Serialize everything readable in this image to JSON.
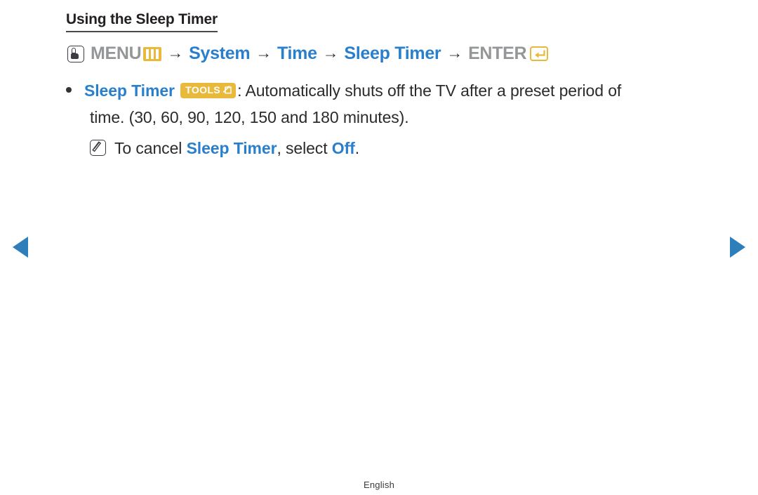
{
  "page": {
    "title": "Using the Sleep Timer",
    "language_footer": "English"
  },
  "menu_path": {
    "press_icon": "menu-press-icon",
    "menu_label": "MENU",
    "menu_bars_icon": "menu-bars-icon",
    "arrow": "→",
    "step1": "System",
    "step2": "Time",
    "step3": "Sleep Timer",
    "enter_label": "ENTER",
    "enter_icon": "enter-return-icon"
  },
  "bullet": {
    "dot": "bullet-dot",
    "feature_name": "Sleep Timer",
    "tools_badge_label": "TOOLS",
    "tools_badge_icon": "tools-arrow-icon",
    "description_line1": ": Automatically shuts off the TV after a preset period of",
    "description_line2": "time. (30, 60, 90, 120, 150 and 180 minutes)."
  },
  "note": {
    "icon": "note-icon",
    "text_before": "To cancel ",
    "highlight1": "Sleep Timer",
    "text_middle": ", select ",
    "highlight2": "Off",
    "text_after": "."
  },
  "navigation": {
    "prev_label": "◀",
    "next_label": "▶"
  },
  "colors": {
    "blue": "#2a7fcd",
    "gold": "#e9b93c",
    "gray": "#949698",
    "text": "#2b2b2b",
    "nav_blue": "#2e7ebc"
  }
}
